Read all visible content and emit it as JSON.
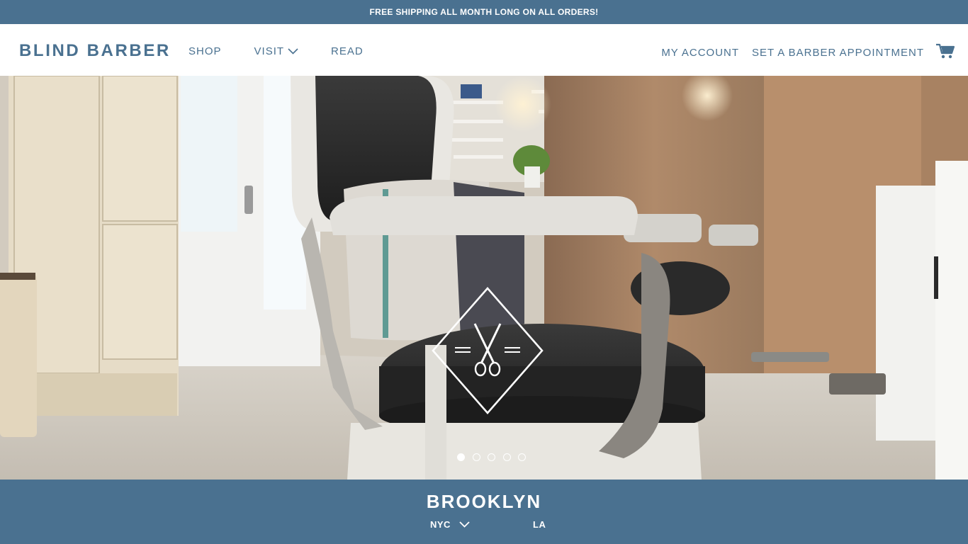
{
  "promo": {
    "text": "FREE SHIPPING ALL MONTH LONG ON ALL ORDERS!"
  },
  "header": {
    "logo": "BLIND BARBER",
    "nav": [
      {
        "label": "SHOP"
      },
      {
        "label": "VISIT",
        "icon": "chevron-down-icon"
      },
      {
        "label": "READ"
      }
    ],
    "account_label": "MY ACCOUNT",
    "appointment_label": "SET A BARBER APPOINTMENT",
    "cart_icon": "cart-icon"
  },
  "hero": {
    "emblem_icon": "scissors-diamond-icon",
    "slides_total": 5,
    "active_slide": 1
  },
  "location": {
    "title": "BROOKLYN",
    "tabs": [
      {
        "label": "NYC",
        "icon": "chevron-down-icon"
      },
      {
        "label": "LA"
      }
    ]
  },
  "colors": {
    "brand": "#4a7190",
    "white": "#ffffff"
  }
}
